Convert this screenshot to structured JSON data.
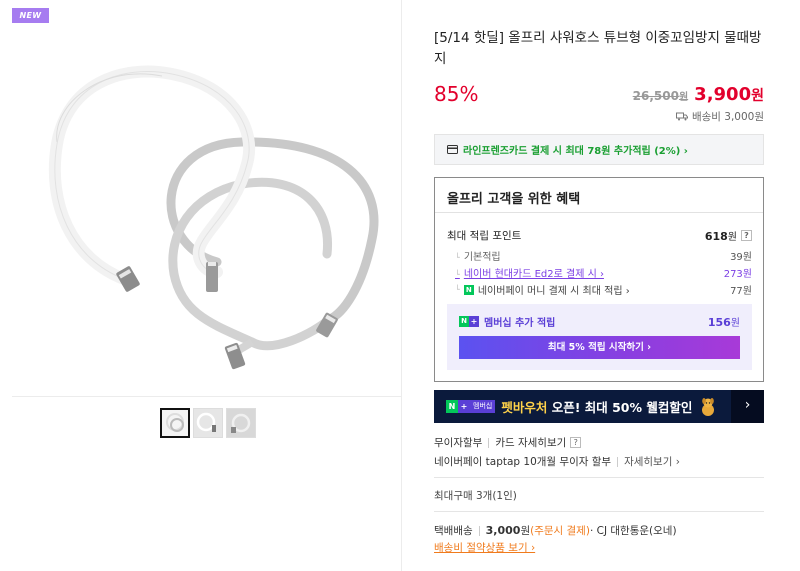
{
  "badge": "NEW",
  "product": {
    "title": "[5/14 핫딜] 올프리 샤워호스 튜브형 이중꼬임방지 물때방지",
    "discount": "85%",
    "original_price": "26,500",
    "original_unit": "원",
    "sale_price": "3,900",
    "sale_unit": "원",
    "shipping_fee": "배송비 3,000원"
  },
  "thumbnails": [
    {
      "name": "thumb-1",
      "active": true
    },
    {
      "name": "thumb-2",
      "active": false
    },
    {
      "name": "thumb-3",
      "active": false
    }
  ],
  "card_banner": "라인프렌즈카드 결제 시 최대 78원 추가적립 (2%) ›",
  "benefits": {
    "title": "올프리 고객을 위한 혜택",
    "max_label": "최대 적립 포인트",
    "max_value": "618",
    "max_unit": "원",
    "help": "?",
    "rows": [
      {
        "label": "기본적립",
        "value": "39원"
      },
      {
        "label": "네이버 현대카드 Ed2로 결제 시 ›",
        "value": "273원"
      },
      {
        "label": "네이버페이 머니 결제 시 최대 적립 ›",
        "value": "77원"
      }
    ],
    "npay_icon": "N",
    "membership_label": "멤버십 추가 적립",
    "membership_value": "156",
    "membership_unit": "원",
    "membership_button": "최대 5% 적립 시작하기 ›"
  },
  "promo": {
    "n": "N",
    "plus": "+",
    "membership_tag": "멤버십",
    "text_a": "펫바우처",
    "text_b": " 오픈! 최대 50% 웰컴할인",
    "arrow": "›"
  },
  "payment": {
    "interest_free": "무이자할부",
    "card_detail": "카드 자세히보기",
    "help": "?",
    "taptap": "네이버페이 taptap 10개월 무이자 할부",
    "detail": "자세히보기 ›"
  },
  "max_purchase": "최대구매 3개(1인)",
  "delivery": {
    "method": "택배배송",
    "price": "3,000",
    "unit": "원",
    "condition": "(주문시 결제)",
    "carrier": " · CJ 대한통운(오네)",
    "link": "배송비 절약상품 보기 ›"
  },
  "colors": {
    "accent_red": "#e2002c",
    "naver_green": "#03c75a",
    "membership_purple": "#5a3fd6",
    "badge_purple": "#a67cf0",
    "promo_bg": "#0b1a3c",
    "orange": "#f07b1d"
  }
}
